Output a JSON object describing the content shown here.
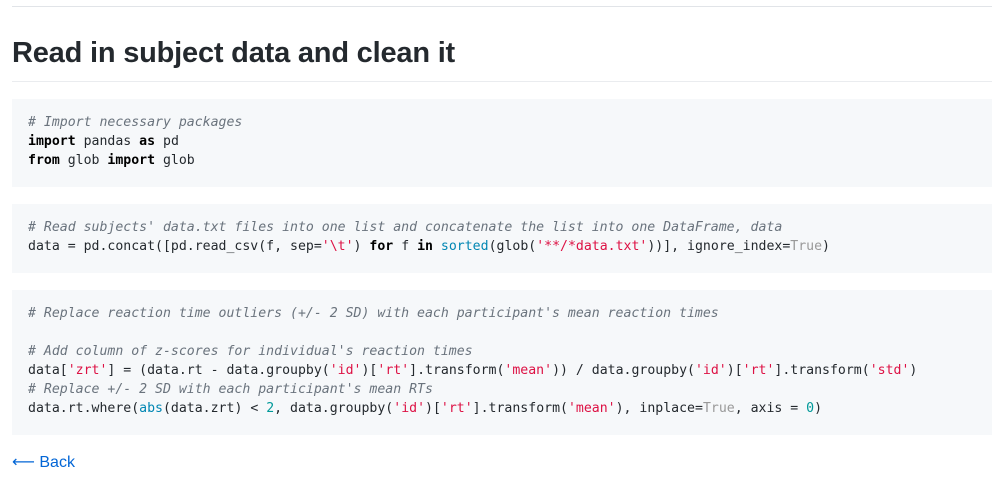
{
  "page": {
    "title": "Read in subject data and clean it"
  },
  "code_blocks": [
    {
      "lines": [
        [
          {
            "t": "c",
            "v": "# Import necessary packages"
          }
        ],
        [
          {
            "t": "k",
            "v": "import"
          },
          {
            "t": "p",
            "v": " pandas "
          },
          {
            "t": "k",
            "v": "as"
          },
          {
            "t": "p",
            "v": " pd"
          }
        ],
        [
          {
            "t": "k",
            "v": "from"
          },
          {
            "t": "p",
            "v": " glob "
          },
          {
            "t": "k",
            "v": "import"
          },
          {
            "t": "p",
            "v": " glob"
          }
        ]
      ]
    },
    {
      "lines": [
        [
          {
            "t": "c",
            "v": "# Read subjects' data.txt files into one list and concatenate the list into one DataFrame, data"
          }
        ],
        [
          {
            "t": "p",
            "v": "data = pd.concat([pd.read_csv(f, sep="
          },
          {
            "t": "s",
            "v": "'\\t'"
          },
          {
            "t": "p",
            "v": ") "
          },
          {
            "t": "k",
            "v": "for"
          },
          {
            "t": "p",
            "v": " f "
          },
          {
            "t": "k",
            "v": "in"
          },
          {
            "t": "p",
            "v": " "
          },
          {
            "t": "b",
            "v": "sorted"
          },
          {
            "t": "p",
            "v": "(glob("
          },
          {
            "t": "s",
            "v": "'**/*data.txt'"
          },
          {
            "t": "p",
            "v": "))], ignore_index="
          },
          {
            "t": "bc",
            "v": "True"
          },
          {
            "t": "p",
            "v": ")"
          }
        ]
      ]
    },
    {
      "lines": [
        [
          {
            "t": "c",
            "v": "# Replace reaction time outliers (+/- 2 SD) with each participant's mean reaction times"
          }
        ],
        [],
        [
          {
            "t": "c",
            "v": "# Add column of z-scores for individual's reaction times"
          }
        ],
        [
          {
            "t": "p",
            "v": "data["
          },
          {
            "t": "s",
            "v": "'zrt'"
          },
          {
            "t": "p",
            "v": "] = (data.rt - data.groupby("
          },
          {
            "t": "s",
            "v": "'id'"
          },
          {
            "t": "p",
            "v": ")["
          },
          {
            "t": "s",
            "v": "'rt'"
          },
          {
            "t": "p",
            "v": "].transform("
          },
          {
            "t": "s",
            "v": "'mean'"
          },
          {
            "t": "p",
            "v": ")) / data.groupby("
          },
          {
            "t": "s",
            "v": "'id'"
          },
          {
            "t": "p",
            "v": ")["
          },
          {
            "t": "s",
            "v": "'rt'"
          },
          {
            "t": "p",
            "v": "].transform("
          },
          {
            "t": "s",
            "v": "'std'"
          },
          {
            "t": "p",
            "v": ")"
          }
        ],
        [
          {
            "t": "c",
            "v": "# Replace +/- 2 SD with each participant's mean RTs"
          }
        ],
        [
          {
            "t": "p",
            "v": "data.rt.where("
          },
          {
            "t": "b",
            "v": "abs"
          },
          {
            "t": "p",
            "v": "(data.zrt) < "
          },
          {
            "t": "n",
            "v": "2"
          },
          {
            "t": "p",
            "v": ", data.groupby("
          },
          {
            "t": "s",
            "v": "'id'"
          },
          {
            "t": "p",
            "v": ")["
          },
          {
            "t": "s",
            "v": "'rt'"
          },
          {
            "t": "p",
            "v": "].transform("
          },
          {
            "t": "s",
            "v": "'mean'"
          },
          {
            "t": "p",
            "v": "), inplace="
          },
          {
            "t": "bc",
            "v": "True"
          },
          {
            "t": "p",
            "v": ", axis = "
          },
          {
            "t": "n",
            "v": "0"
          },
          {
            "t": "p",
            "v": ")"
          }
        ]
      ]
    }
  ],
  "back_link": {
    "label": "⟵ Back"
  }
}
